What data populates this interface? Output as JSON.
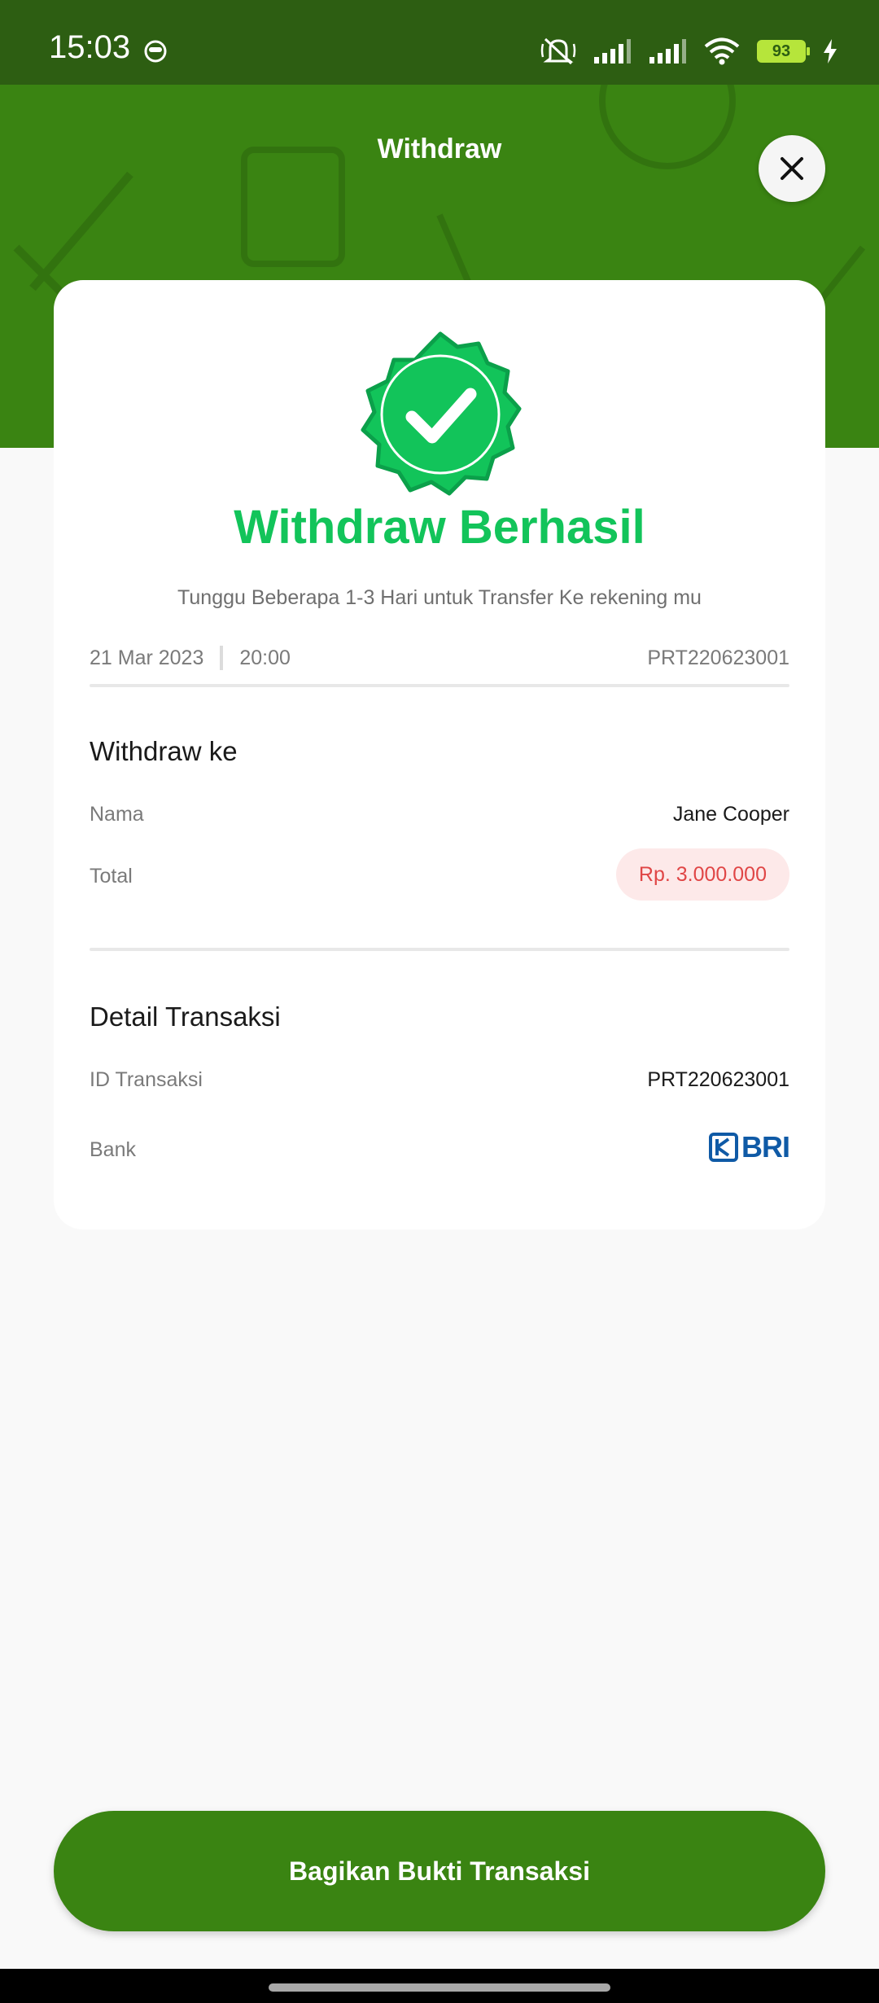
{
  "status_bar": {
    "time": "15:03",
    "battery": "93",
    "icons": [
      "face-icon",
      "mute-icon",
      "signal-icon",
      "signal-icon",
      "wifi-icon",
      "battery-icon",
      "charging-icon"
    ]
  },
  "header": {
    "title": "Withdraw",
    "close_icon": "close-icon",
    "background_color": "#3a8412"
  },
  "result": {
    "icon": "success-badge-icon",
    "title": "Withdraw Berhasil",
    "subtitle": "Tunggu Beberapa 1-3 Hari untuk Transfer Ke rekening mu",
    "date": "21 Mar 2023",
    "time": "20:00",
    "code": "PRT220623001",
    "accent_color": "#12c45a"
  },
  "withdraw_to": {
    "title": "Withdraw ke",
    "rows": [
      {
        "label": "Nama",
        "value": "Jane Cooper"
      },
      {
        "label": "Total",
        "value": "Rp. 3.000.000"
      }
    ]
  },
  "transaction_detail": {
    "title": "Detail Transaksi",
    "rows": [
      {
        "label": "ID Transaksi",
        "value": "PRT220623001"
      },
      {
        "label": "Bank",
        "value": "BRI"
      }
    ]
  },
  "actions": {
    "share_label": "Bagikan Bukti Transaksi"
  }
}
